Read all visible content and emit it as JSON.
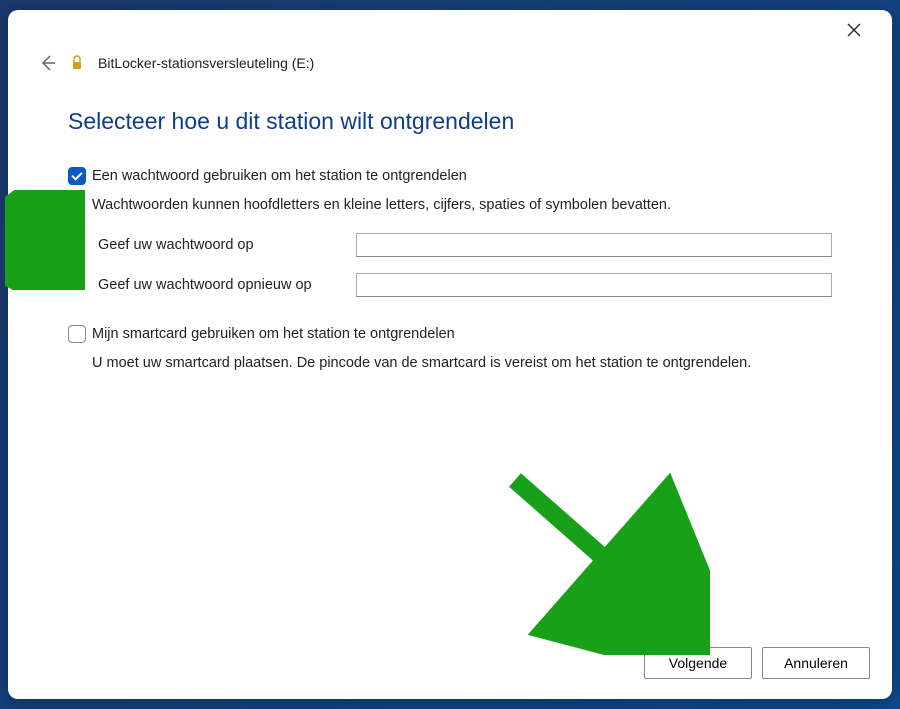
{
  "header": {
    "app_title": "BitLocker-stationsversleuteling (E:)"
  },
  "content": {
    "heading": "Selecteer hoe u dit station wilt ontgrendelen",
    "option_password": {
      "checked": true,
      "label": "Een wachtwoord gebruiken om het station te ontgrendelen",
      "description": "Wachtwoorden kunnen hoofdletters en kleine letters, cijfers, spaties of symbolen bevatten.",
      "field_password_label": "Geef uw wachtwoord op",
      "field_confirm_label": "Geef uw wachtwoord opnieuw op"
    },
    "option_smartcard": {
      "checked": false,
      "label": "Mijn smartcard gebruiken om het station te ontgrendelen",
      "description": "U moet uw smartcard plaatsen. De pincode van de smartcard is vereist om het station te ontgrendelen."
    }
  },
  "footer": {
    "next_label": "Volgende",
    "cancel_label": "Annuleren"
  },
  "colors": {
    "accent": "#0a5ac2",
    "heading": "#0b3d91",
    "arrow": "#18a018"
  }
}
